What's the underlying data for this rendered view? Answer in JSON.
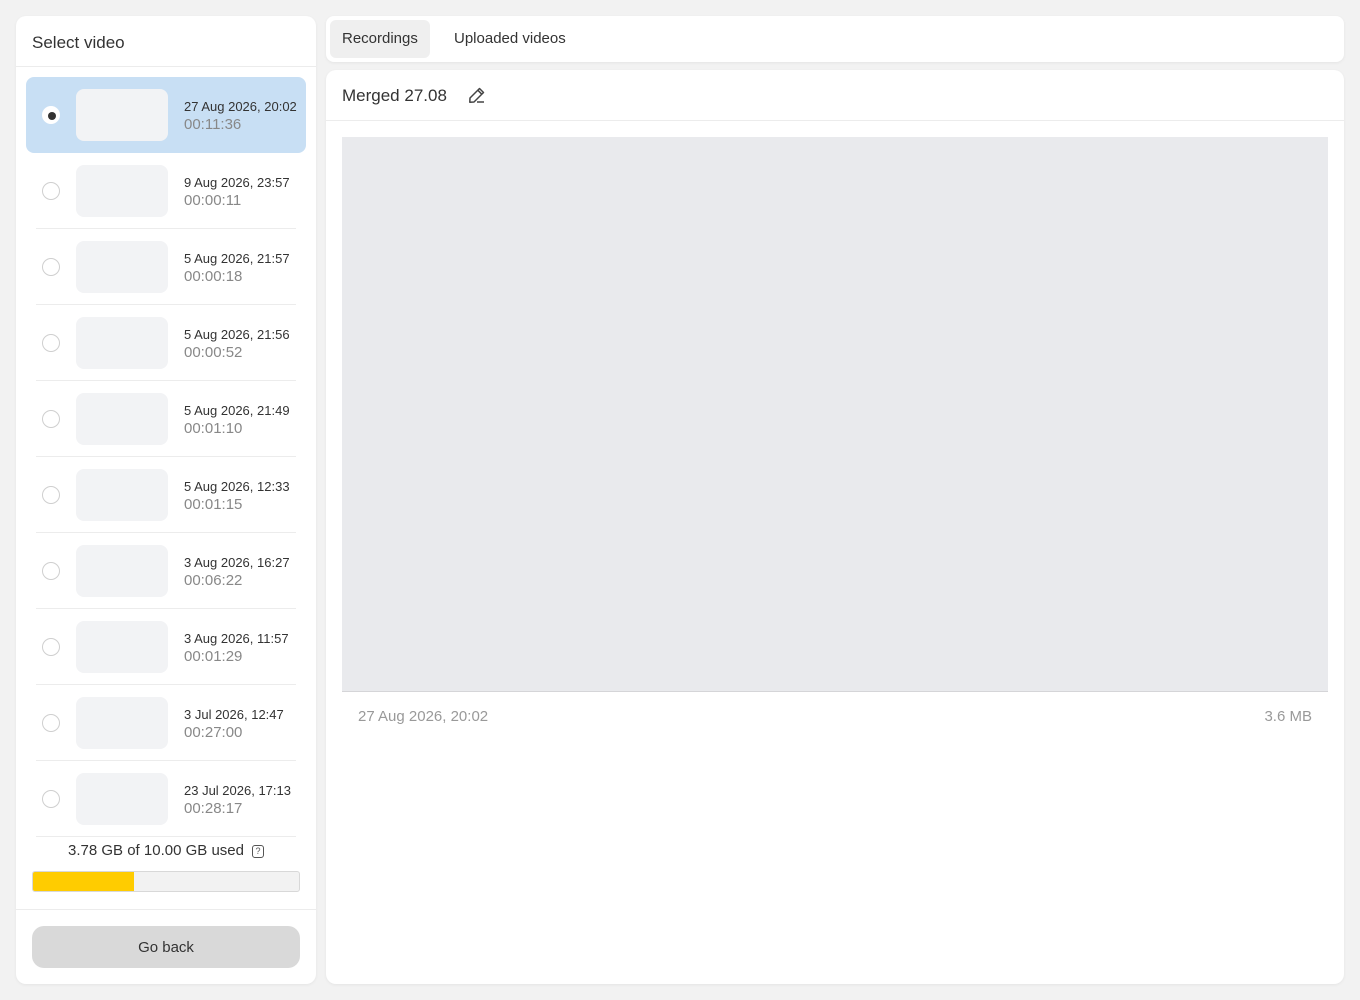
{
  "sidebar": {
    "title": "Select video",
    "items": [
      {
        "date": "27 Aug 2026, 20:02",
        "duration": "00:11:36",
        "selected": true
      },
      {
        "date": "9 Aug 2026, 23:57",
        "duration": "00:00:11",
        "selected": false
      },
      {
        "date": "5 Aug 2026, 21:57",
        "duration": "00:00:18",
        "selected": false
      },
      {
        "date": "5 Aug 2026, 21:56",
        "duration": "00:00:52",
        "selected": false
      },
      {
        "date": "5 Aug 2026, 21:49",
        "duration": "00:01:10",
        "selected": false
      },
      {
        "date": "5 Aug 2026, 12:33",
        "duration": "00:01:15",
        "selected": false
      },
      {
        "date": "3 Aug 2026, 16:27",
        "duration": "00:06:22",
        "selected": false
      },
      {
        "date": "3 Aug 2026, 11:57",
        "duration": "00:01:29",
        "selected": false
      },
      {
        "date": "3 Jul 2026, 12:47",
        "duration": "00:27:00",
        "selected": false
      },
      {
        "date": "23 Jul 2026, 17:13",
        "duration": "00:28:17",
        "selected": false
      }
    ],
    "storage": {
      "text": "3.78 GB of 10.00 GB used",
      "used_fraction": 0.378,
      "bar_color": "#ffcc00"
    },
    "go_back_label": "Go back"
  },
  "tabs": {
    "recordings": "Recordings",
    "uploaded": "Uploaded videos",
    "active": "recordings"
  },
  "main": {
    "title": "Merged 27.08",
    "edit_icon": "pencil-icon",
    "preview_date": "27 Aug 2026, 20:02",
    "preview_size": "3.6 MB"
  },
  "colors": {
    "selected_bg": "#c8dff4",
    "accent": "#ffcc00"
  }
}
